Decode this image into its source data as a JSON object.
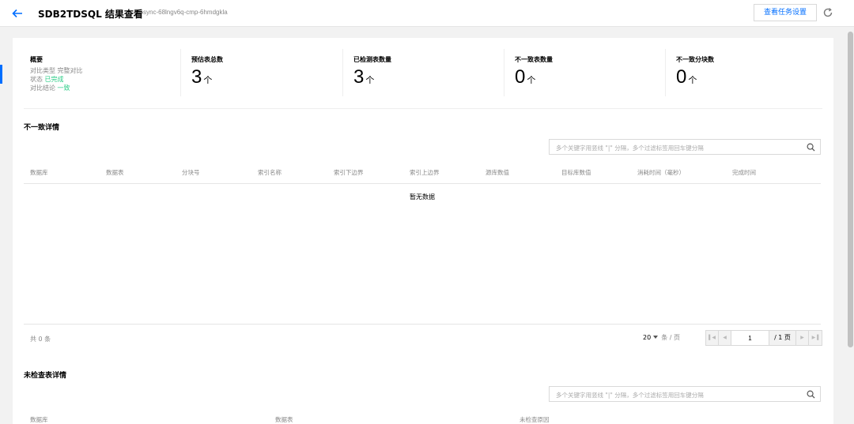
{
  "header": {
    "title": "SDB2TDSQL 结果查看",
    "task_id": "sync-68lngv6q-cmp-6hmdgkla",
    "settings_label": "查看任务设置"
  },
  "summary": {
    "overview_title": "概要",
    "compare_type_key": "对比类型",
    "compare_type_value": "完整对比",
    "status_key": "状态",
    "status_value": "已完成",
    "conclusion_key": "对比结论",
    "conclusion_value": "一致",
    "stats": [
      {
        "label": "预估表总数",
        "value": "3",
        "unit": "个"
      },
      {
        "label": "已检测表数量",
        "value": "3",
        "unit": "个"
      },
      {
        "label": "不一致表数量",
        "value": "0",
        "unit": "个"
      },
      {
        "label": "不一致分块数",
        "value": "0",
        "unit": "个"
      }
    ]
  },
  "inconsistent": {
    "title": "不一致详情",
    "search_placeholder": "多个关键字用竖线 \"|\" 分隔，多个过滤标签用回车键分隔",
    "columns": [
      "数据库",
      "数据表",
      "分块号",
      "索引名称",
      "索引下边界",
      "索引上边界",
      "源库数值",
      "目标库数值",
      "消耗时间（毫秒）",
      "完成时间"
    ],
    "empty_text": "暂无数据",
    "total_text": "共 0 条",
    "page_size": "20",
    "page_size_unit": "条 / 页",
    "current_page": "1",
    "total_pages": "/ 1 页"
  },
  "unchecked": {
    "title": "未检查表详情",
    "search_placeholder": "多个关键字用竖线 \"|\" 分隔，多个过滤标签用回车键分隔",
    "columns": [
      "数据库",
      "数据表",
      "未检查原因"
    ]
  },
  "colors": {
    "accent": "#006eff",
    "success": "#29cc85"
  }
}
